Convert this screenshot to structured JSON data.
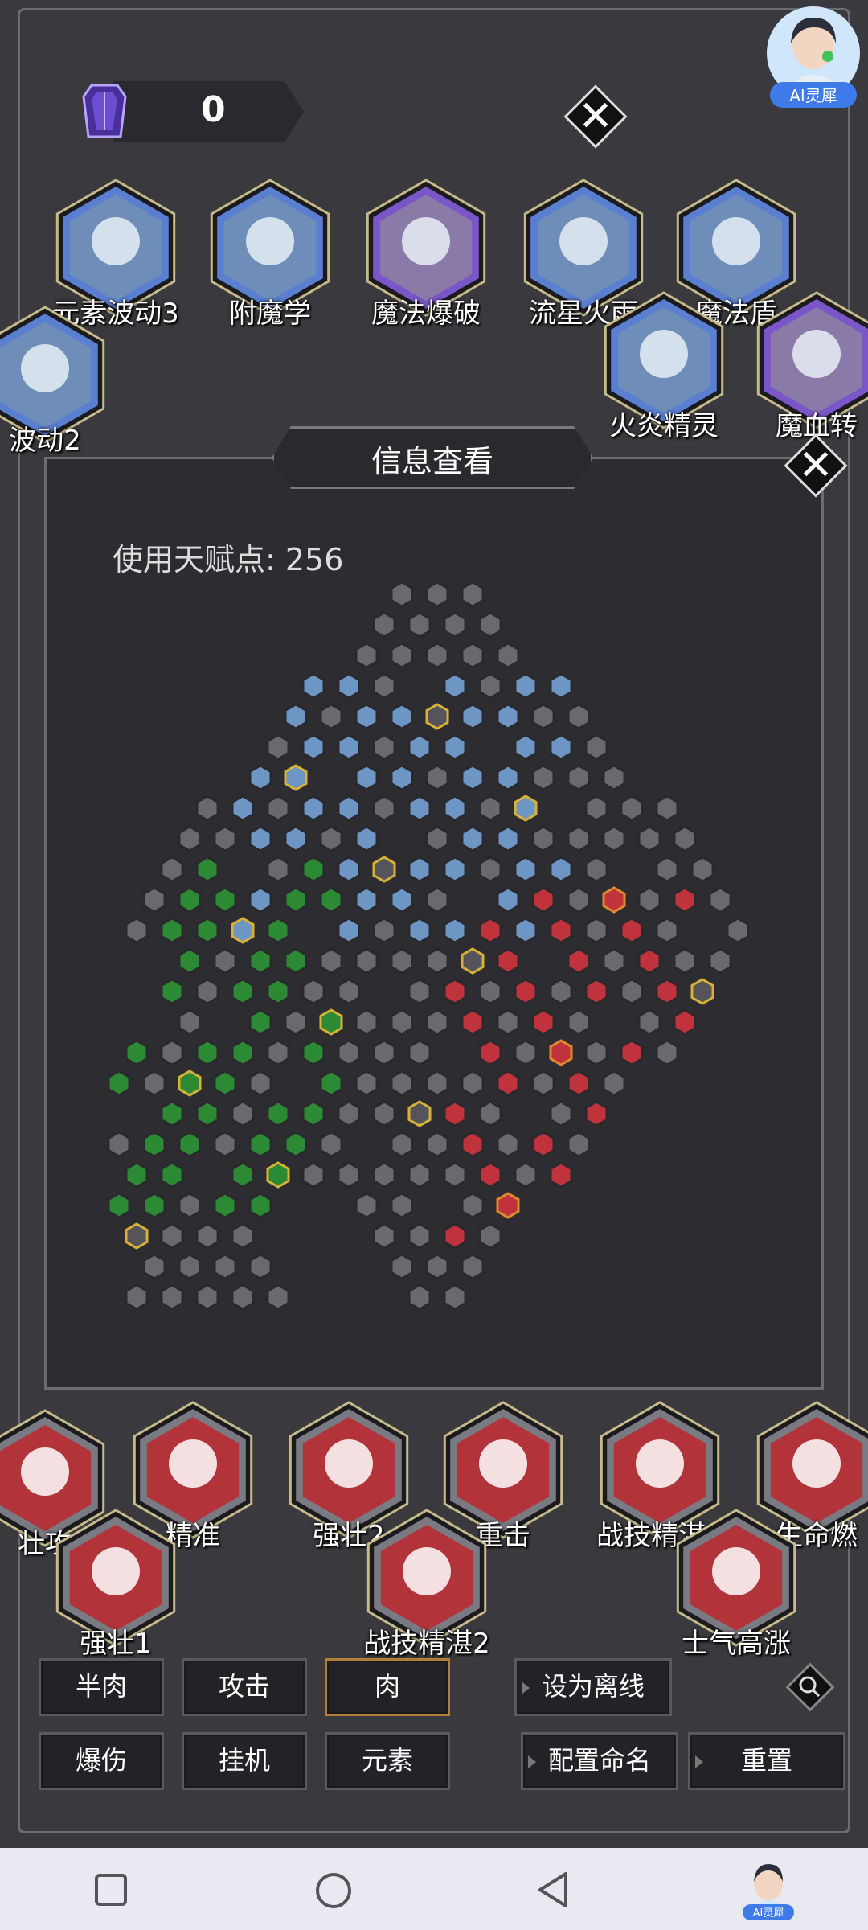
{
  "currency": {
    "value": "0",
    "icon": "purple-crystal-icon"
  },
  "ai_assistant": {
    "label": "AI灵犀"
  },
  "skills_top": [
    {
      "id": "elem",
      "label": "元素波动3",
      "theme": "blue",
      "icon": "pillar-icon"
    },
    {
      "id": "ench",
      "label": "附魔学",
      "theme": "blue",
      "icon": "scroll-icon"
    },
    {
      "id": "blast",
      "label": "魔法爆破",
      "theme": "purple",
      "icon": "burst-icon"
    },
    {
      "id": "meteor",
      "label": "流星火雨",
      "theme": "blue",
      "icon": "meteor-icon"
    },
    {
      "id": "shield",
      "label": "魔法盾",
      "theme": "blue",
      "icon": "shield-icon"
    },
    {
      "id": "elem2",
      "label": "波动2",
      "theme": "blue",
      "icon": "pillar-icon"
    },
    {
      "id": "spirit",
      "label": "火炎精灵",
      "theme": "blue",
      "icon": "spirit-icon"
    },
    {
      "id": "bloodmana",
      "label": "魔血转",
      "theme": "purple",
      "icon": "blood-icon"
    }
  ],
  "skills_bottom": [
    {
      "id": "atk",
      "label": "壮攻",
      "theme": "red",
      "icon": "flex-icon"
    },
    {
      "id": "acc",
      "label": "精准",
      "theme": "red",
      "icon": "target-icon"
    },
    {
      "id": "str2",
      "label": "强壮2",
      "theme": "red",
      "icon": "muscle-icon"
    },
    {
      "id": "heavy",
      "label": "重击",
      "theme": "red",
      "icon": "hammer-icon"
    },
    {
      "id": "tech3",
      "label": "战技精湛3",
      "theme": "red",
      "icon": "star-burst-icon"
    },
    {
      "id": "life",
      "label": "生命燃",
      "theme": "red",
      "icon": "flame-icon"
    },
    {
      "id": "str1",
      "label": "强壮1",
      "theme": "red",
      "icon": "muscle-icon"
    },
    {
      "id": "tech2",
      "label": "战技精湛2",
      "theme": "red",
      "icon": "sword-icon"
    },
    {
      "id": "morale",
      "label": "士气高涨",
      "theme": "red",
      "icon": "crowd-icon"
    }
  ],
  "info_panel": {
    "title": "信息查看",
    "talent_points_label": "使用天赋点: 256"
  },
  "hex_legend": {
    "gray": "#6a696e",
    "blue": "#6e96c4",
    "red": "#c0323c",
    "green": "#2c8a34",
    "purple": "#7b6bb0",
    "yellow_outline": "#d8b236",
    "orange_outline": "#e08a2c"
  },
  "buttons": {
    "preset1": "半肉",
    "preset2": "攻击",
    "preset3": "肉",
    "preset4": "爆伤",
    "preset5": "挂机",
    "preset6": "元素",
    "set_offline": "设为离线",
    "config_name": "配置命名",
    "reset": "重置"
  },
  "navbar": {
    "ai_label": "AI灵犀"
  }
}
